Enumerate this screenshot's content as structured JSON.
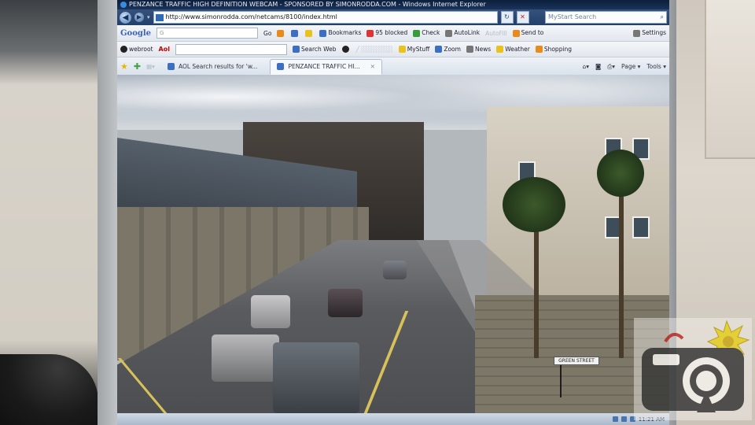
{
  "window": {
    "title": "PENZANCE TRAFFIC HIGH DEFINITION WEBCAM - SPONSORED BY SIMONRODDA.COM - Windows Internet Explorer"
  },
  "address_bar": {
    "url": "http://www.simonrodda.com/netcams/8100/index.html",
    "search_placeholder": "MyStart Search"
  },
  "google_toolbar": {
    "logo": "Google",
    "search_prefix": "G",
    "go": "Go",
    "items": [
      "Bookmarks",
      "95 blocked",
      "Check",
      "AutoLink",
      "AutoFill",
      "Send to"
    ],
    "settings": "Settings"
  },
  "second_toolbar": {
    "webroot": "webroot",
    "aol": "Aol",
    "search_web": "Search Web",
    "mystuff": "MyStuff",
    "zoom": "Zoom",
    "news": "News",
    "weather": "Weather",
    "shopping": "Shopping"
  },
  "tabs": {
    "items": [
      {
        "label": "AOL Search results for 'w...",
        "active": false
      },
      {
        "label": "PENZANCE TRAFFIC HI...",
        "active": true
      }
    ],
    "page_menu": "Page",
    "tools_menu": "Tools"
  },
  "street": {
    "sign_text": "GREEN STREET"
  },
  "taskbar": {
    "clock": "11:21 AM"
  },
  "colors": {
    "titlebar": "#0c1f3c",
    "addressbar": "#23406b",
    "toolbar": "#e2e7ee",
    "road_line": "#d6c15a",
    "watermark_sun": "#e8d020"
  },
  "watermark": {
    "icon": "camera-logo-icon"
  }
}
